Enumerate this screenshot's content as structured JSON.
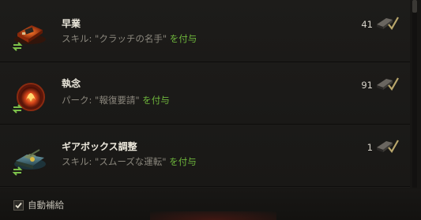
{
  "items": [
    {
      "title": "早業",
      "desc_prefix": "スキル: ",
      "desc_name": "\"クラッチの名手\"",
      "action": "を付与",
      "count": "41",
      "icon": "clutch-braking-icon"
    },
    {
      "title": "執念",
      "desc_prefix": "パーク: ",
      "desc_name": "\"報復要請\"",
      "action": "を付与",
      "count": "91",
      "icon": "obsession-fire-icon"
    },
    {
      "title": "ギアボックス調整",
      "desc_prefix": "スキル: ",
      "desc_name": "\"スムーズな運転\"",
      "action": "を付与",
      "count": "1",
      "icon": "gearbox-tank-icon"
    }
  ],
  "footer": {
    "auto_restock_label": "自動補給",
    "auto_restock_checked": true
  },
  "colors": {
    "action_green": "#6fb73c",
    "swap_green": "#7cc04a",
    "title": "#ece8dc",
    "description": "#8b877d"
  }
}
